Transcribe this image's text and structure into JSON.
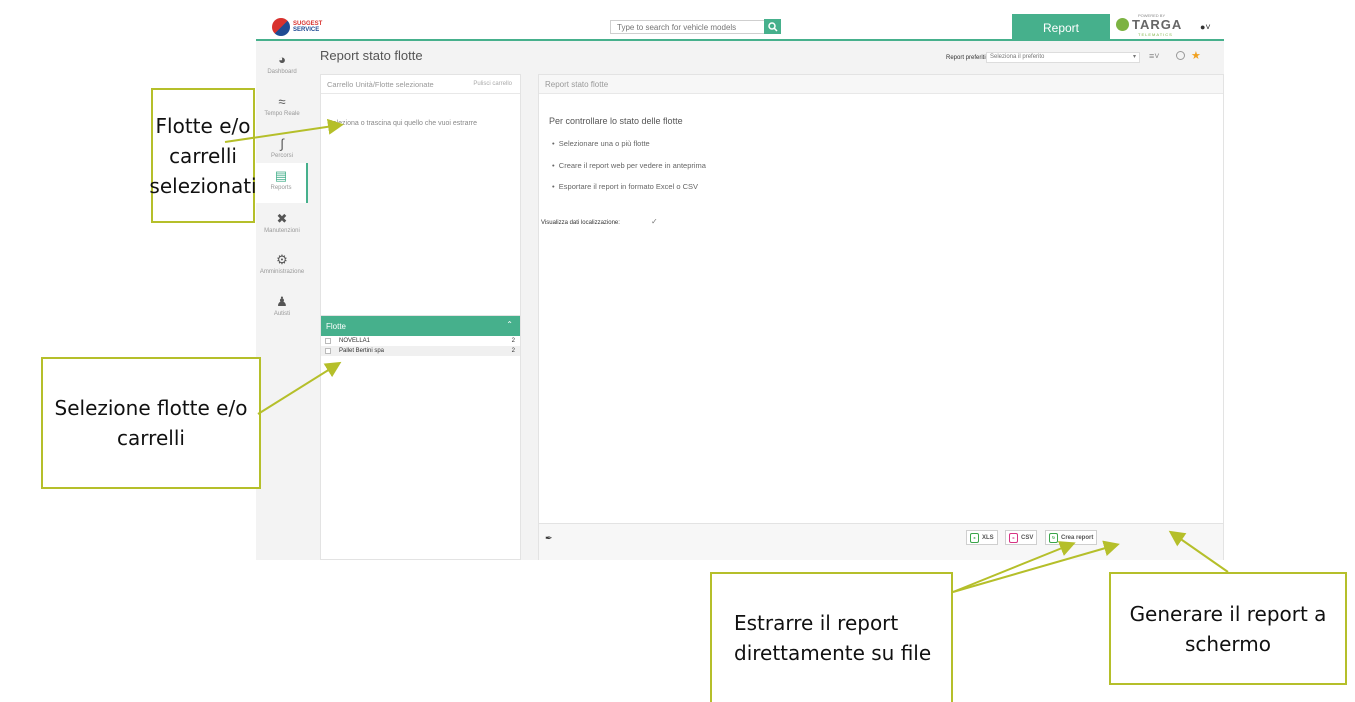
{
  "header": {
    "logo_line1": "SUGGEST",
    "logo_line2": "SERVICE",
    "search_placeholder": "Type to search for vehicle models",
    "report_tab": "Report",
    "brand_powered": "POWERED BY",
    "brand_name": "TARGA",
    "brand_sub": "TELEMATICS"
  },
  "sidebar": {
    "items": [
      {
        "label": "Dashboard",
        "icon": "speedometer-icon"
      },
      {
        "label": "Tempo Reale",
        "icon": "wifi-icon"
      },
      {
        "label": "Percorsi",
        "icon": "route-icon"
      },
      {
        "label": "Reports",
        "icon": "report-icon"
      },
      {
        "label": "Manutenzioni",
        "icon": "tools-icon"
      },
      {
        "label": "Amministrazione",
        "icon": "gears-icon"
      },
      {
        "label": "Autisti",
        "icon": "drivers-icon"
      }
    ]
  },
  "page": {
    "title": "Report stato flotte",
    "pref_label": "Report preferiti:",
    "pref_placeholder": "Seleziona il preferito"
  },
  "cart": {
    "title": "Carrello Unità/Flotte selezionate",
    "clear": "Pulisci carrello",
    "empty": "Seleziona o trascina qui quello che vuoi estrarre"
  },
  "fleets": {
    "title": "Flotte",
    "rows": [
      {
        "name": "NOVELLA1",
        "count": "2"
      },
      {
        "name": "Pallet Bertini spa",
        "count": "2"
      }
    ]
  },
  "main": {
    "title": "Report stato flotte",
    "intro": "Per controllare lo stato delle flotte",
    "steps": [
      "Selezionare una o più flotte",
      "Creare il report web per vedere in anteprima",
      "Esportare il report in formato Excel o CSV"
    ],
    "loc_label": "Visualizza dati localizzazione:",
    "btn_xls": "XLS",
    "btn_csv": "CSV",
    "btn_create": "Crea report"
  },
  "callouts": {
    "selected": "Flotte e/o carrelli selezionati",
    "selection": "Selezione flotte e/o carrelli",
    "export": "Estrarre il report direttamente su file",
    "generate": "Generare il report a schermo"
  },
  "colors": {
    "accent": "#46b08c",
    "callout_border": "#b5bf2a"
  }
}
